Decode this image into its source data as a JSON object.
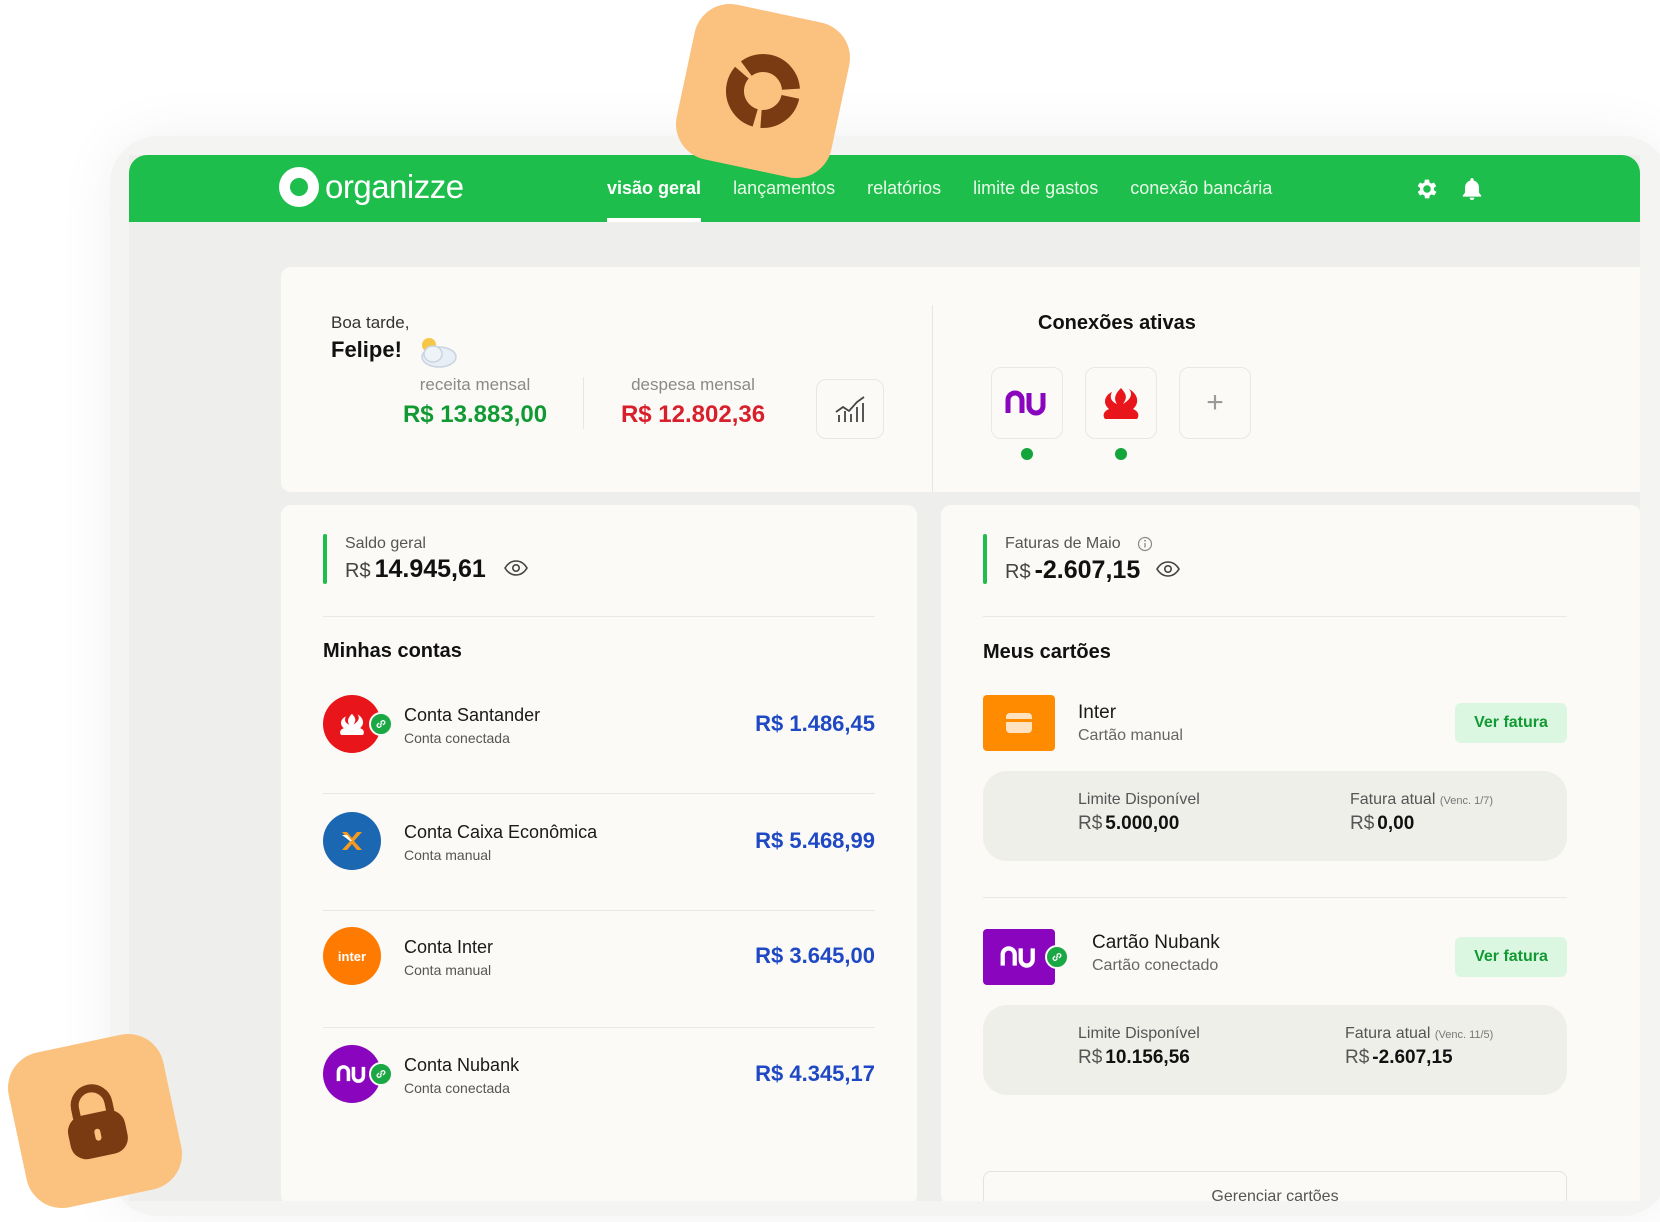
{
  "header": {
    "logo": "organizze",
    "nav": [
      "visão geral",
      "lançamentos",
      "relatórios",
      "limite de gastos",
      "conexão bancária"
    ]
  },
  "summary": {
    "greeting": "Boa tarde,",
    "name": "Felipe!",
    "income_label": "receita mensal",
    "income_value": "R$ 13.883,00",
    "expense_label": "despesa mensal",
    "expense_value": "R$ 12.802,36",
    "connections_title": "Conexões ativas",
    "banks": [
      {
        "name": "nu",
        "status": "active"
      },
      {
        "name": "santander",
        "status": "active"
      }
    ]
  },
  "balance": {
    "label": "Saldo geral",
    "currency": "R$",
    "value": "14.945,61"
  },
  "accounts": {
    "title": "Minhas contas",
    "items": [
      {
        "name": "Conta Santander",
        "sub": "Conta conectada",
        "balance": "R$ 1.486,45",
        "color": "#e8151b"
      },
      {
        "name": "Conta Caixa Econômica",
        "sub": "Conta manual",
        "balance": "R$ 5.468,99",
        "color": "#1c67b1"
      },
      {
        "name": "Conta Inter",
        "sub": "Conta manual",
        "balance": "R$ 3.645,00",
        "logo_text": "inter",
        "color": "#ff7a00"
      },
      {
        "name": "Conta Nubank",
        "sub": "Conta conectada",
        "balance": "R$ 4.345,17",
        "color": "#8a05be"
      }
    ]
  },
  "invoices": {
    "label": "Faturas de Maio",
    "currency": "R$",
    "value": "-2.607,15"
  },
  "cards": {
    "title": "Meus cartões",
    "items": [
      {
        "name": "Inter",
        "sub": "Cartão manual",
        "button": "Ver fatura",
        "limit_label": "Limite Disponível",
        "limit_currency": "R$",
        "limit_value": "5.000,00",
        "invoice_label": "Fatura atual",
        "invoice_due": "(Venc. 1/7)",
        "invoice_currency": "R$",
        "invoice_value": "0,00",
        "color": "#ff8c00"
      },
      {
        "name": "Cartão Nubank",
        "sub": "Cartão conectado",
        "button": "Ver fatura",
        "limit_label": "Limite Disponível",
        "limit_currency": "R$",
        "limit_value": "10.156,56",
        "invoice_label": "Fatura atual",
        "invoice_due": "(Venc. 11/5)",
        "invoice_currency": "R$",
        "invoice_value": "-2.607,15",
        "color": "#8a05be"
      }
    ],
    "manage_label": "Gerenciar cartões"
  },
  "icons": [
    "donut-chart-icon",
    "lock-icon",
    "gear-icon",
    "bell-icon",
    "trend-chart-icon",
    "eye-icon",
    "info-icon",
    "link-icon",
    "card-icon",
    "plus-icon",
    "cloud-sun-icon"
  ],
  "colors": {
    "brand_green": "#1dbe4b",
    "income_green": "#119a33",
    "expense_red": "#d81f2c",
    "balance_blue": "#1f49c4",
    "accent_orange": "#fbc17f"
  }
}
